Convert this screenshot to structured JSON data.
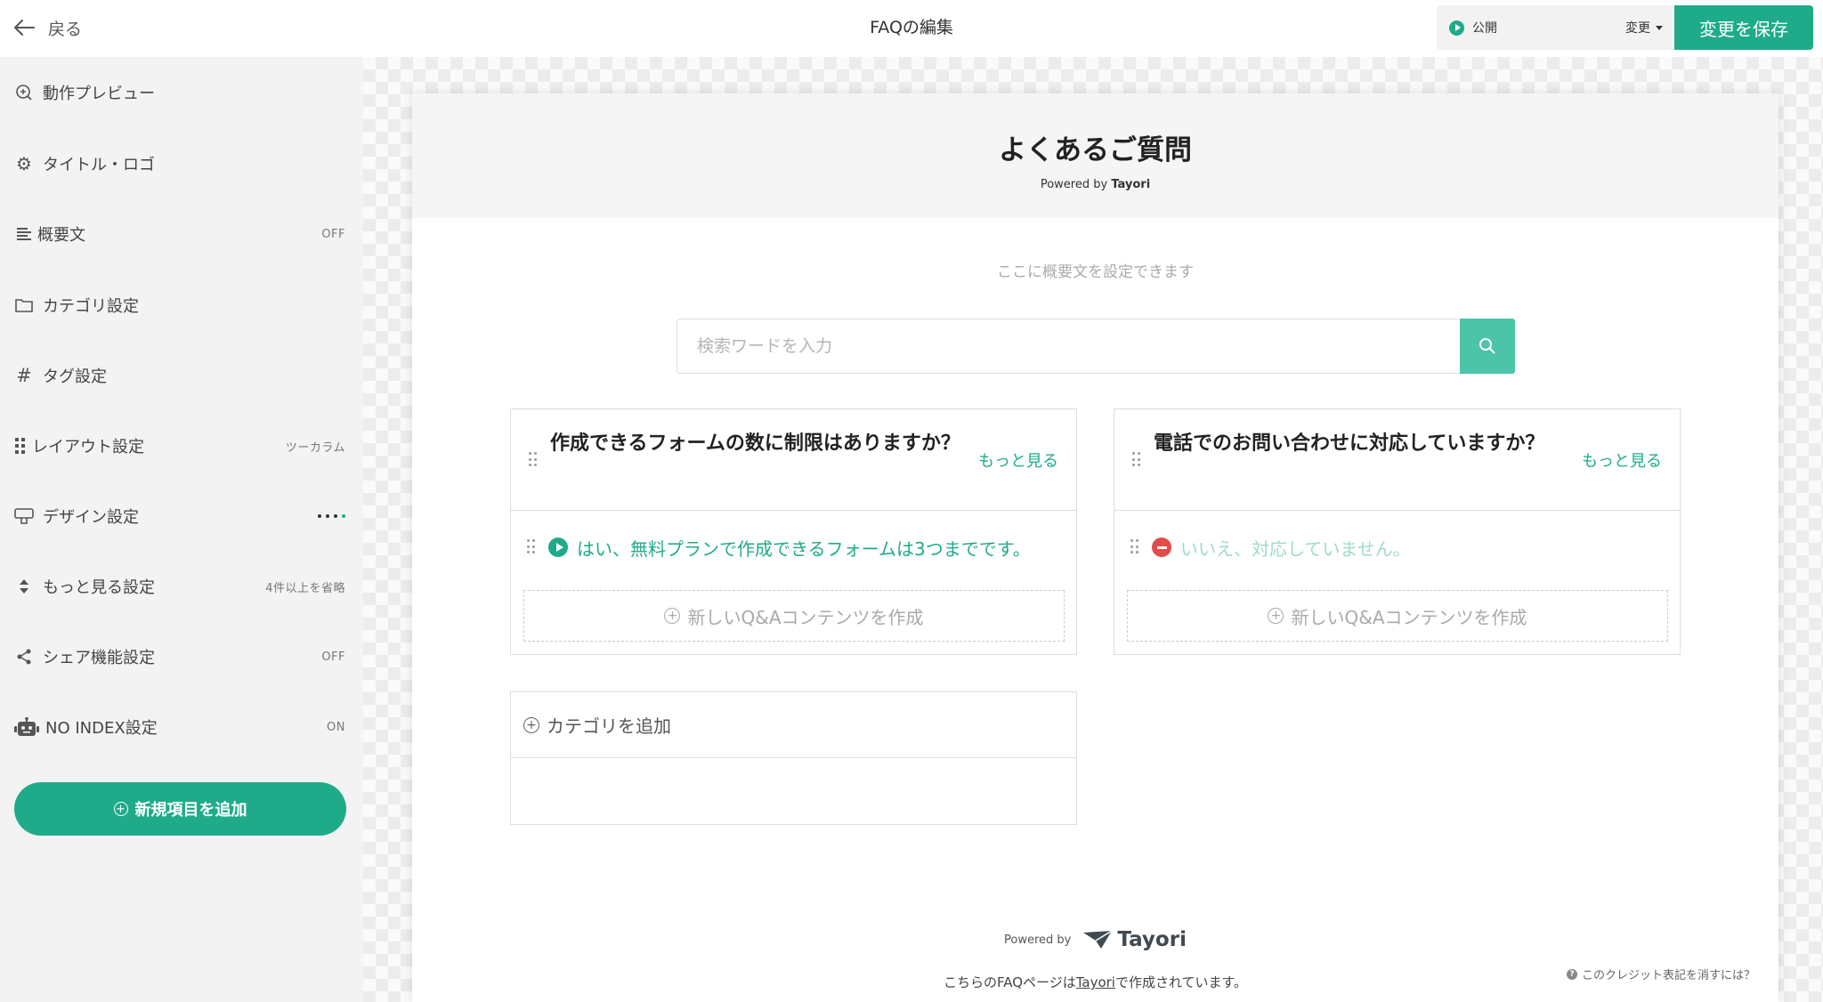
{
  "header": {
    "back_label": "戻る",
    "title": "FAQの編集",
    "status_label": "公開",
    "status_change_label": "変更",
    "save_label": "変更を保存"
  },
  "sidebar": {
    "items": [
      {
        "icon": "search-icon",
        "label": "動作プレビュー",
        "value": ""
      },
      {
        "icon": "gear-icon",
        "label": "タイトル・ロゴ",
        "value": ""
      },
      {
        "icon": "align-left-icon",
        "label": "概要文",
        "value": "OFF"
      },
      {
        "icon": "folder-icon",
        "label": "カテゴリ設定",
        "value": ""
      },
      {
        "icon": "hash-icon",
        "label": "タグ設定",
        "value": ""
      },
      {
        "icon": "grid-icon",
        "label": "レイアウト設定",
        "value": "ツーカラム"
      },
      {
        "icon": "palette-icon",
        "label": "デザイン設定",
        "value": ""
      },
      {
        "icon": "sort-icon",
        "label": "もっと見る設定",
        "value": "4件以上を省略"
      },
      {
        "icon": "share-icon",
        "label": "シェア機能設定",
        "value": "OFF"
      },
      {
        "icon": "robot-icon",
        "label": "NO INDEX設定",
        "value": "ON"
      }
    ],
    "add_label": "新規項目を追加"
  },
  "faq": {
    "title": "よくあるご質問",
    "powered_prefix": "Powered by ",
    "powered_brand": "Tayori",
    "summary_placeholder": "ここに概要文を設定できます",
    "search_placeholder": "検索ワードを入力",
    "categories": [
      {
        "title": "作成できるフォームの数に制限はありますか？",
        "more_label": "もっと見る",
        "qa_text": "はい、無料プランで作成できるフォームは3つまでです。",
        "qa_status": "published",
        "new_qa_label": "新しいQ&Aコンテンツを作成"
      },
      {
        "title": "電話でのお問い合わせに対応していますか？",
        "more_label": "もっと見る",
        "qa_text": "いいえ、対応していません。",
        "qa_status": "unpublished",
        "new_qa_label": "新しいQ&Aコンテンツを作成"
      }
    ],
    "add_category_label": "カテゴリを追加"
  },
  "footer": {
    "powered_by": "Powered by",
    "logo_text": "Tayori",
    "credit_prefix": "こちらのFAQページは",
    "credit_link": "Tayori",
    "credit_suffix": "で作成されています。",
    "remove_credit": "このクレジット表記を消すには？"
  },
  "colors": {
    "accent": "#1fab8a",
    "accent_light": "#4cc4a8",
    "unpublished": "#e24b4b"
  }
}
